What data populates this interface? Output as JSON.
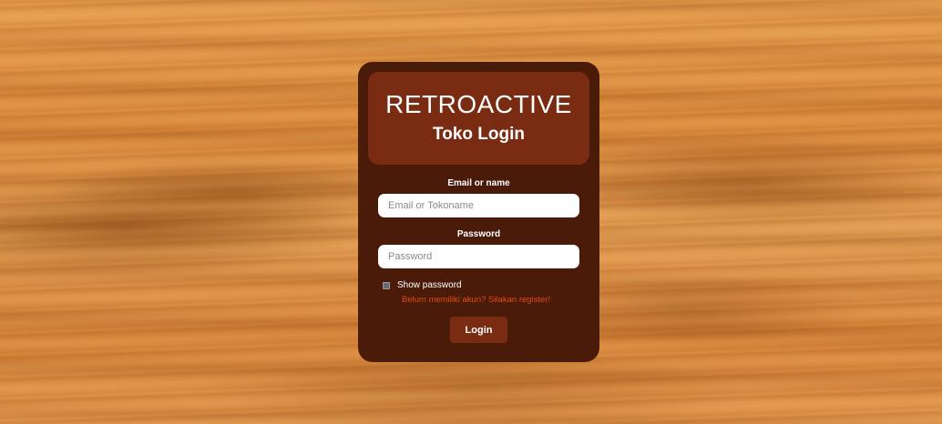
{
  "header": {
    "brand": "RETROACTIVE",
    "subtitle": "Toko Login"
  },
  "form": {
    "email_label": "Email or name",
    "email_placeholder": "Email or Tokoname",
    "email_value": "",
    "password_label": "Password",
    "password_placeholder": "Password",
    "password_value": "",
    "show_password_label": "Show password",
    "show_password_checked": false,
    "register_link": "Belum memiliki akun? Silakan register!",
    "login_button": "Login"
  },
  "colors": {
    "card_bg": "#4a1b08",
    "header_bg": "#7a2c13",
    "button_bg": "#7a2c13",
    "link_color": "#e04a1c",
    "background_wood": "#dd9142"
  }
}
